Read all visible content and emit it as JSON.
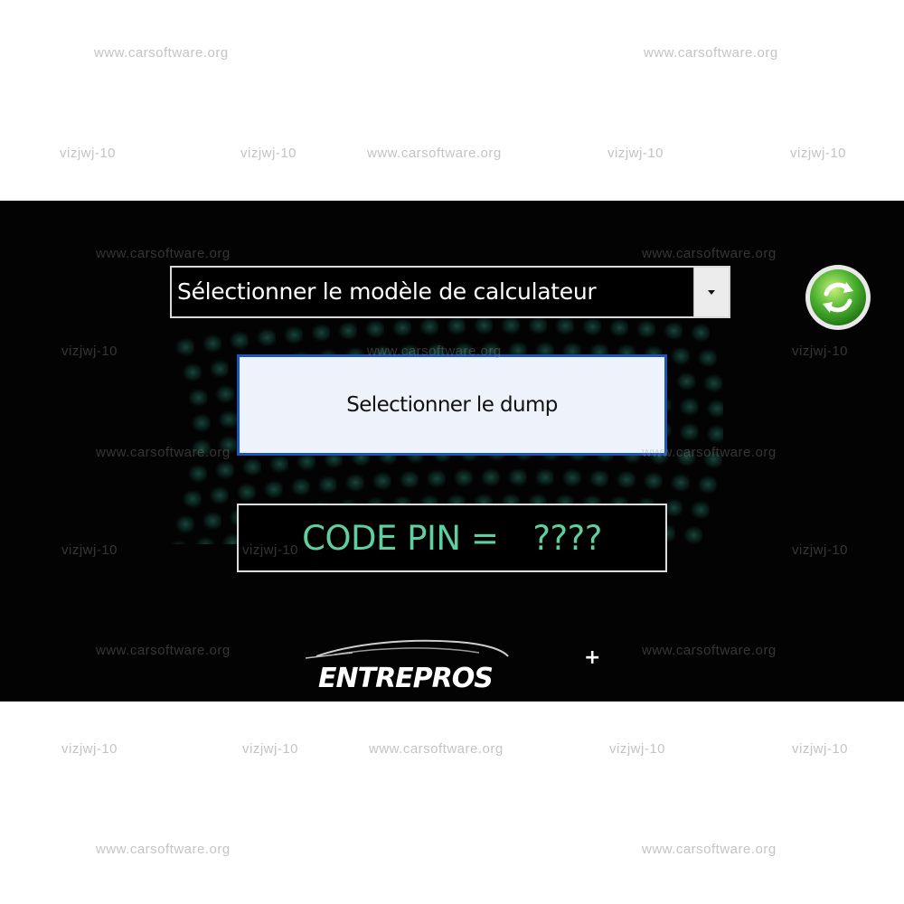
{
  "app": {
    "model_dropdown": {
      "selected": "Sélectionner le modèle de calculateur"
    },
    "refresh_button": {
      "icon": "refresh-icon",
      "color": "#3aa52c"
    },
    "dump_button": {
      "label": "Selectionner le dump"
    },
    "pin_display": {
      "label": "CODE PIN =",
      "value": "????",
      "color": "#5fcfa0"
    },
    "logo": {
      "text": "ENTREPROS",
      "plus": "+"
    }
  },
  "watermarks": {
    "site": "www.carsoftware.org",
    "tag": "vizjwj-10"
  }
}
